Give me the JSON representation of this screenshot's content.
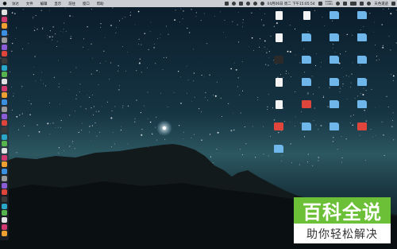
{
  "menubar": {
    "items": [
      "访达",
      "文件",
      "编辑",
      "显示",
      "前往",
      "窗口",
      "帮助"
    ],
    "network_speed": [
      "62KB/s",
      "1.0KB/s"
    ],
    "clock": "04月06日 周二 下午15:05:54",
    "search_label": "天色遗迹"
  },
  "desktop": {
    "files": [
      {
        "name": "",
        "kind": "doc"
      },
      {
        "name": "",
        "kind": "doc"
      },
      {
        "name": "",
        "kind": "folder"
      },
      {
        "name": "",
        "kind": "folder"
      },
      {
        "name": "",
        "kind": "doc"
      },
      {
        "name": "",
        "kind": "folder"
      },
      {
        "name": "",
        "kind": "folder"
      },
      {
        "name": "",
        "kind": "folder"
      },
      {
        "name": "",
        "kind": "dark"
      },
      {
        "name": "",
        "kind": "folder"
      },
      {
        "name": "",
        "kind": "folder"
      },
      {
        "name": "",
        "kind": "folder"
      },
      {
        "name": "",
        "kind": "doc"
      },
      {
        "name": "",
        "kind": "folder"
      },
      {
        "name": "",
        "kind": "folder"
      },
      {
        "name": "",
        "kind": "folder"
      },
      {
        "name": "",
        "kind": "doc"
      },
      {
        "name": "",
        "kind": "red"
      },
      {
        "name": "",
        "kind": "folder"
      },
      {
        "name": "",
        "kind": "folder"
      },
      {
        "name": "",
        "kind": "red"
      },
      {
        "name": "",
        "kind": "folder"
      },
      {
        "name": "",
        "kind": "folder"
      },
      {
        "name": "",
        "kind": "red"
      },
      {
        "name": "",
        "kind": "folder"
      }
    ]
  },
  "watermark": {
    "title": "百科全说",
    "subtitle": "助你轻松解决"
  },
  "colors": {
    "sky_top": "#0b1e2e",
    "sky_horizon": "#2f5a66",
    "logo_green": "#6cc038"
  }
}
